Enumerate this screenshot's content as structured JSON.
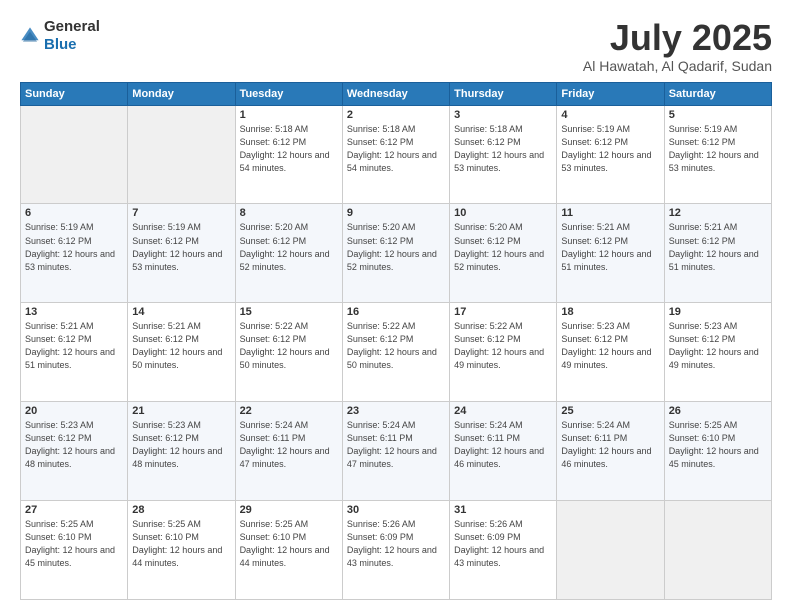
{
  "logo": {
    "general": "General",
    "blue": "Blue"
  },
  "header": {
    "month": "July 2025",
    "location": "Al Hawatah, Al Qadarif, Sudan"
  },
  "weekdays": [
    "Sunday",
    "Monday",
    "Tuesday",
    "Wednesday",
    "Thursday",
    "Friday",
    "Saturday"
  ],
  "weeks": [
    [
      {
        "day": "",
        "sunrise": "",
        "sunset": "",
        "daylight": ""
      },
      {
        "day": "",
        "sunrise": "",
        "sunset": "",
        "daylight": ""
      },
      {
        "day": "1",
        "sunrise": "Sunrise: 5:18 AM",
        "sunset": "Sunset: 6:12 PM",
        "daylight": "Daylight: 12 hours and 54 minutes."
      },
      {
        "day": "2",
        "sunrise": "Sunrise: 5:18 AM",
        "sunset": "Sunset: 6:12 PM",
        "daylight": "Daylight: 12 hours and 54 minutes."
      },
      {
        "day": "3",
        "sunrise": "Sunrise: 5:18 AM",
        "sunset": "Sunset: 6:12 PM",
        "daylight": "Daylight: 12 hours and 53 minutes."
      },
      {
        "day": "4",
        "sunrise": "Sunrise: 5:19 AM",
        "sunset": "Sunset: 6:12 PM",
        "daylight": "Daylight: 12 hours and 53 minutes."
      },
      {
        "day": "5",
        "sunrise": "Sunrise: 5:19 AM",
        "sunset": "Sunset: 6:12 PM",
        "daylight": "Daylight: 12 hours and 53 minutes."
      }
    ],
    [
      {
        "day": "6",
        "sunrise": "Sunrise: 5:19 AM",
        "sunset": "Sunset: 6:12 PM",
        "daylight": "Daylight: 12 hours and 53 minutes."
      },
      {
        "day": "7",
        "sunrise": "Sunrise: 5:19 AM",
        "sunset": "Sunset: 6:12 PM",
        "daylight": "Daylight: 12 hours and 53 minutes."
      },
      {
        "day": "8",
        "sunrise": "Sunrise: 5:20 AM",
        "sunset": "Sunset: 6:12 PM",
        "daylight": "Daylight: 12 hours and 52 minutes."
      },
      {
        "day": "9",
        "sunrise": "Sunrise: 5:20 AM",
        "sunset": "Sunset: 6:12 PM",
        "daylight": "Daylight: 12 hours and 52 minutes."
      },
      {
        "day": "10",
        "sunrise": "Sunrise: 5:20 AM",
        "sunset": "Sunset: 6:12 PM",
        "daylight": "Daylight: 12 hours and 52 minutes."
      },
      {
        "day": "11",
        "sunrise": "Sunrise: 5:21 AM",
        "sunset": "Sunset: 6:12 PM",
        "daylight": "Daylight: 12 hours and 51 minutes."
      },
      {
        "day": "12",
        "sunrise": "Sunrise: 5:21 AM",
        "sunset": "Sunset: 6:12 PM",
        "daylight": "Daylight: 12 hours and 51 minutes."
      }
    ],
    [
      {
        "day": "13",
        "sunrise": "Sunrise: 5:21 AM",
        "sunset": "Sunset: 6:12 PM",
        "daylight": "Daylight: 12 hours and 51 minutes."
      },
      {
        "day": "14",
        "sunrise": "Sunrise: 5:21 AM",
        "sunset": "Sunset: 6:12 PM",
        "daylight": "Daylight: 12 hours and 50 minutes."
      },
      {
        "day": "15",
        "sunrise": "Sunrise: 5:22 AM",
        "sunset": "Sunset: 6:12 PM",
        "daylight": "Daylight: 12 hours and 50 minutes."
      },
      {
        "day": "16",
        "sunrise": "Sunrise: 5:22 AM",
        "sunset": "Sunset: 6:12 PM",
        "daylight": "Daylight: 12 hours and 50 minutes."
      },
      {
        "day": "17",
        "sunrise": "Sunrise: 5:22 AM",
        "sunset": "Sunset: 6:12 PM",
        "daylight": "Daylight: 12 hours and 49 minutes."
      },
      {
        "day": "18",
        "sunrise": "Sunrise: 5:23 AM",
        "sunset": "Sunset: 6:12 PM",
        "daylight": "Daylight: 12 hours and 49 minutes."
      },
      {
        "day": "19",
        "sunrise": "Sunrise: 5:23 AM",
        "sunset": "Sunset: 6:12 PM",
        "daylight": "Daylight: 12 hours and 49 minutes."
      }
    ],
    [
      {
        "day": "20",
        "sunrise": "Sunrise: 5:23 AM",
        "sunset": "Sunset: 6:12 PM",
        "daylight": "Daylight: 12 hours and 48 minutes."
      },
      {
        "day": "21",
        "sunrise": "Sunrise: 5:23 AM",
        "sunset": "Sunset: 6:12 PM",
        "daylight": "Daylight: 12 hours and 48 minutes."
      },
      {
        "day": "22",
        "sunrise": "Sunrise: 5:24 AM",
        "sunset": "Sunset: 6:11 PM",
        "daylight": "Daylight: 12 hours and 47 minutes."
      },
      {
        "day": "23",
        "sunrise": "Sunrise: 5:24 AM",
        "sunset": "Sunset: 6:11 PM",
        "daylight": "Daylight: 12 hours and 47 minutes."
      },
      {
        "day": "24",
        "sunrise": "Sunrise: 5:24 AM",
        "sunset": "Sunset: 6:11 PM",
        "daylight": "Daylight: 12 hours and 46 minutes."
      },
      {
        "day": "25",
        "sunrise": "Sunrise: 5:24 AM",
        "sunset": "Sunset: 6:11 PM",
        "daylight": "Daylight: 12 hours and 46 minutes."
      },
      {
        "day": "26",
        "sunrise": "Sunrise: 5:25 AM",
        "sunset": "Sunset: 6:10 PM",
        "daylight": "Daylight: 12 hours and 45 minutes."
      }
    ],
    [
      {
        "day": "27",
        "sunrise": "Sunrise: 5:25 AM",
        "sunset": "Sunset: 6:10 PM",
        "daylight": "Daylight: 12 hours and 45 minutes."
      },
      {
        "day": "28",
        "sunrise": "Sunrise: 5:25 AM",
        "sunset": "Sunset: 6:10 PM",
        "daylight": "Daylight: 12 hours and 44 minutes."
      },
      {
        "day": "29",
        "sunrise": "Sunrise: 5:25 AM",
        "sunset": "Sunset: 6:10 PM",
        "daylight": "Daylight: 12 hours and 44 minutes."
      },
      {
        "day": "30",
        "sunrise": "Sunrise: 5:26 AM",
        "sunset": "Sunset: 6:09 PM",
        "daylight": "Daylight: 12 hours and 43 minutes."
      },
      {
        "day": "31",
        "sunrise": "Sunrise: 5:26 AM",
        "sunset": "Sunset: 6:09 PM",
        "daylight": "Daylight: 12 hours and 43 minutes."
      },
      {
        "day": "",
        "sunrise": "",
        "sunset": "",
        "daylight": ""
      },
      {
        "day": "",
        "sunrise": "",
        "sunset": "",
        "daylight": ""
      }
    ]
  ]
}
